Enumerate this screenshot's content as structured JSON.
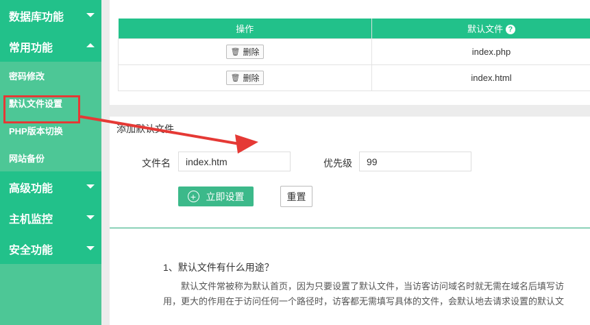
{
  "sidebar": {
    "categories": [
      {
        "label": "数据库功能"
      },
      {
        "label": "常用功能"
      },
      {
        "label": "高级功能"
      },
      {
        "label": "主机监控"
      },
      {
        "label": "安全功能"
      }
    ],
    "sub_items": [
      {
        "label": "密码修改"
      },
      {
        "label": "默认文件设置"
      },
      {
        "label": "PHP版本切换"
      },
      {
        "label": "网站备份"
      }
    ]
  },
  "files_table": {
    "headers": {
      "operation": "操作",
      "default_file": "默认文件",
      "help_glyph": "?"
    },
    "rows": [
      {
        "action": "删除",
        "file": "index.php"
      },
      {
        "action": "删除",
        "file": "index.html"
      }
    ]
  },
  "add_form": {
    "title": "添加默认文件",
    "filename_label": "文件名",
    "filename_value": "index.htm",
    "priority_label": "优先级",
    "priority_value": "99",
    "submit_label": "立即设置",
    "reset_label": "重置"
  },
  "faq": {
    "question": "1、默认文件有什么用途？",
    "answer_line1": "默认文件常被称为默认首页，因为只要设置了默认文件，当访客访问域名时就无需在域名后填写访",
    "answer_line2": "用，更大的作用在于访问任何一个路径时，访客都无需填写具体的文件，会默认地去请求设置的默认文"
  },
  "colors": {
    "accent": "#22c18a",
    "sidebar": "#4dc796",
    "highlight": "#e53935"
  }
}
